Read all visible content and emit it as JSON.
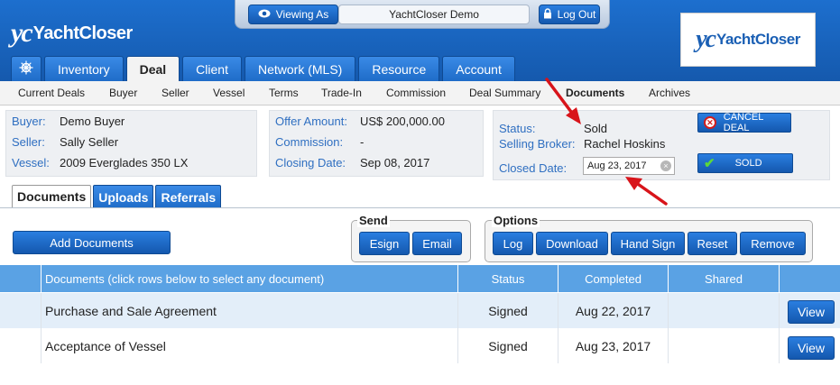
{
  "header": {
    "logo_mark": "yc",
    "logo_text": "YachtCloser",
    "viewing_as_label": "Viewing As",
    "demo_name": "YachtCloser Demo",
    "logout_label": "Log Out",
    "brand_logo_mark": "yc",
    "brand_logo_text": "YachtCloser"
  },
  "main_tabs": [
    "Inventory",
    "Deal",
    "Client",
    "Network (MLS)",
    "Resource",
    "Account"
  ],
  "subnav": [
    "Current Deals",
    "Buyer",
    "Seller",
    "Vessel",
    "Terms",
    "Trade-In",
    "Commission",
    "Deal Summary",
    "Documents",
    "Archives"
  ],
  "deal_info": {
    "buyer_label": "Buyer:",
    "buyer": "Demo Buyer",
    "seller_label": "Seller:",
    "seller": "Sally Seller",
    "vessel_label": "Vessel:",
    "vessel": "2009 Everglades 350 LX"
  },
  "offer_info": {
    "offer_label": "Offer Amount:",
    "offer": "US$ 200,000.00",
    "commission_label": "Commission:",
    "commission": "-",
    "closing_label": "Closing Date:",
    "closing": "Sep 08, 2017"
  },
  "status_info": {
    "status_label": "Status:",
    "status": "Sold",
    "broker_label": "Selling Broker:",
    "broker": "Rachel Hoskins",
    "closed_label": "Closed Date:",
    "closed": "Aug 23, 2017",
    "cancel_label": "CANCEL DEAL",
    "sold_label": "SOLD"
  },
  "doc_tabs": [
    "Documents",
    "Uploads",
    "Referrals"
  ],
  "actions": {
    "add_documents": "Add Documents",
    "send_title": "Send",
    "send_buttons": [
      "Esign",
      "Email"
    ],
    "options_title": "Options",
    "option_buttons": [
      "Log",
      "Download",
      "Hand Sign",
      "Reset",
      "Remove"
    ]
  },
  "table": {
    "headers": [
      "Documents (click rows below to select any document)",
      "Status",
      "Completed",
      "Shared"
    ],
    "rows": [
      {
        "document": "Purchase and Sale Agreement",
        "status": "Signed",
        "completed": "Aug 22, 2017",
        "shared": "",
        "action": "View"
      },
      {
        "document": "Acceptance of Vessel",
        "status": "Signed",
        "completed": "Aug 23, 2017",
        "shared": "",
        "action": "View"
      }
    ]
  },
  "colors": {
    "header_blue": "#1d6fce",
    "link_blue": "#2f6fc1",
    "table_header": "#5aa2e4",
    "annotation_arrow": "#d8141a"
  }
}
